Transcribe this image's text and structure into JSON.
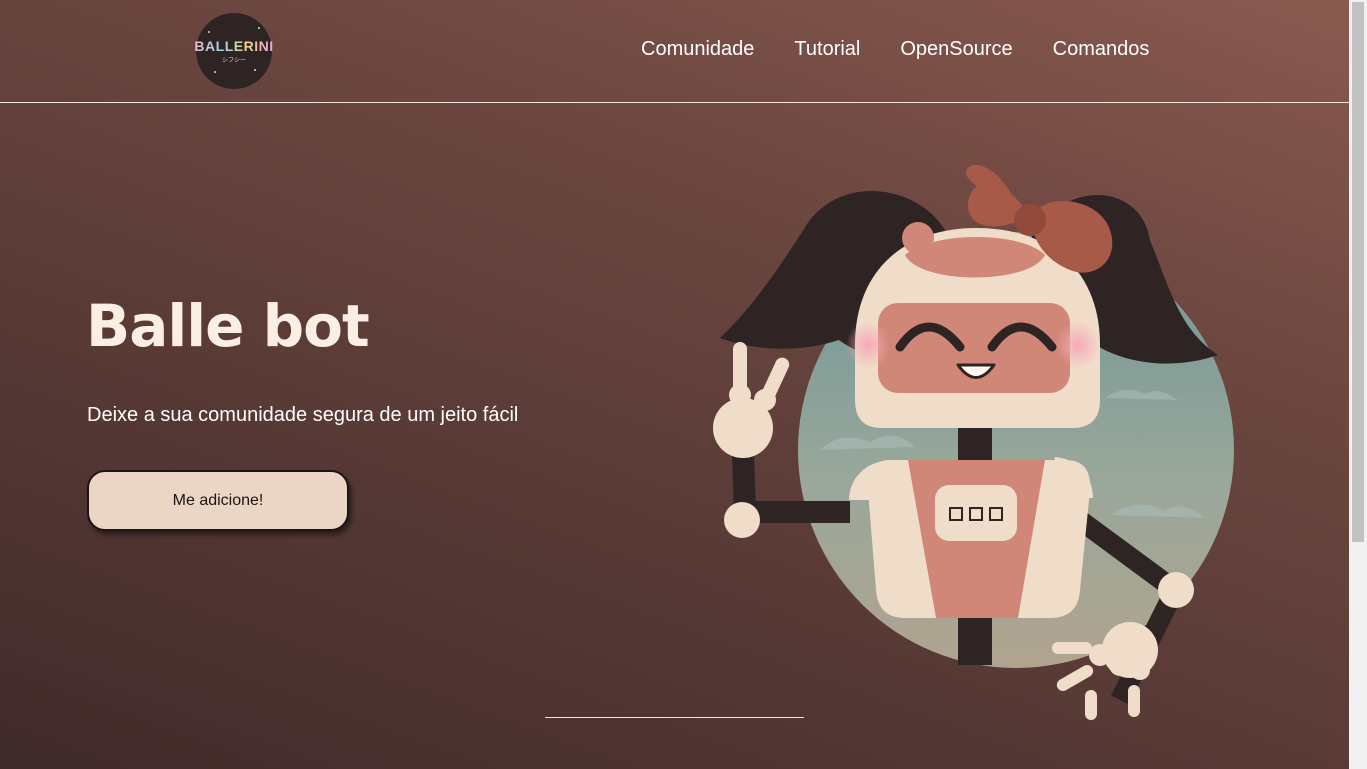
{
  "header": {
    "logo": {
      "brand": "BALLERINI",
      "tagline": "シフシー"
    },
    "nav": [
      {
        "label": "Comunidade"
      },
      {
        "label": "Tutorial"
      },
      {
        "label": "OpenSource"
      },
      {
        "label": "Comandos"
      }
    ]
  },
  "hero": {
    "title": "Balle bot",
    "subtitle": "Deixe a sua comunidade segura de um jeito fácil",
    "cta_label": "Me adicione!"
  },
  "colors": {
    "background_dark": "#3f2b2a",
    "background_light": "#8a5a50",
    "cta_background": "#ebd6c5",
    "title_color": "#fbeee4"
  }
}
